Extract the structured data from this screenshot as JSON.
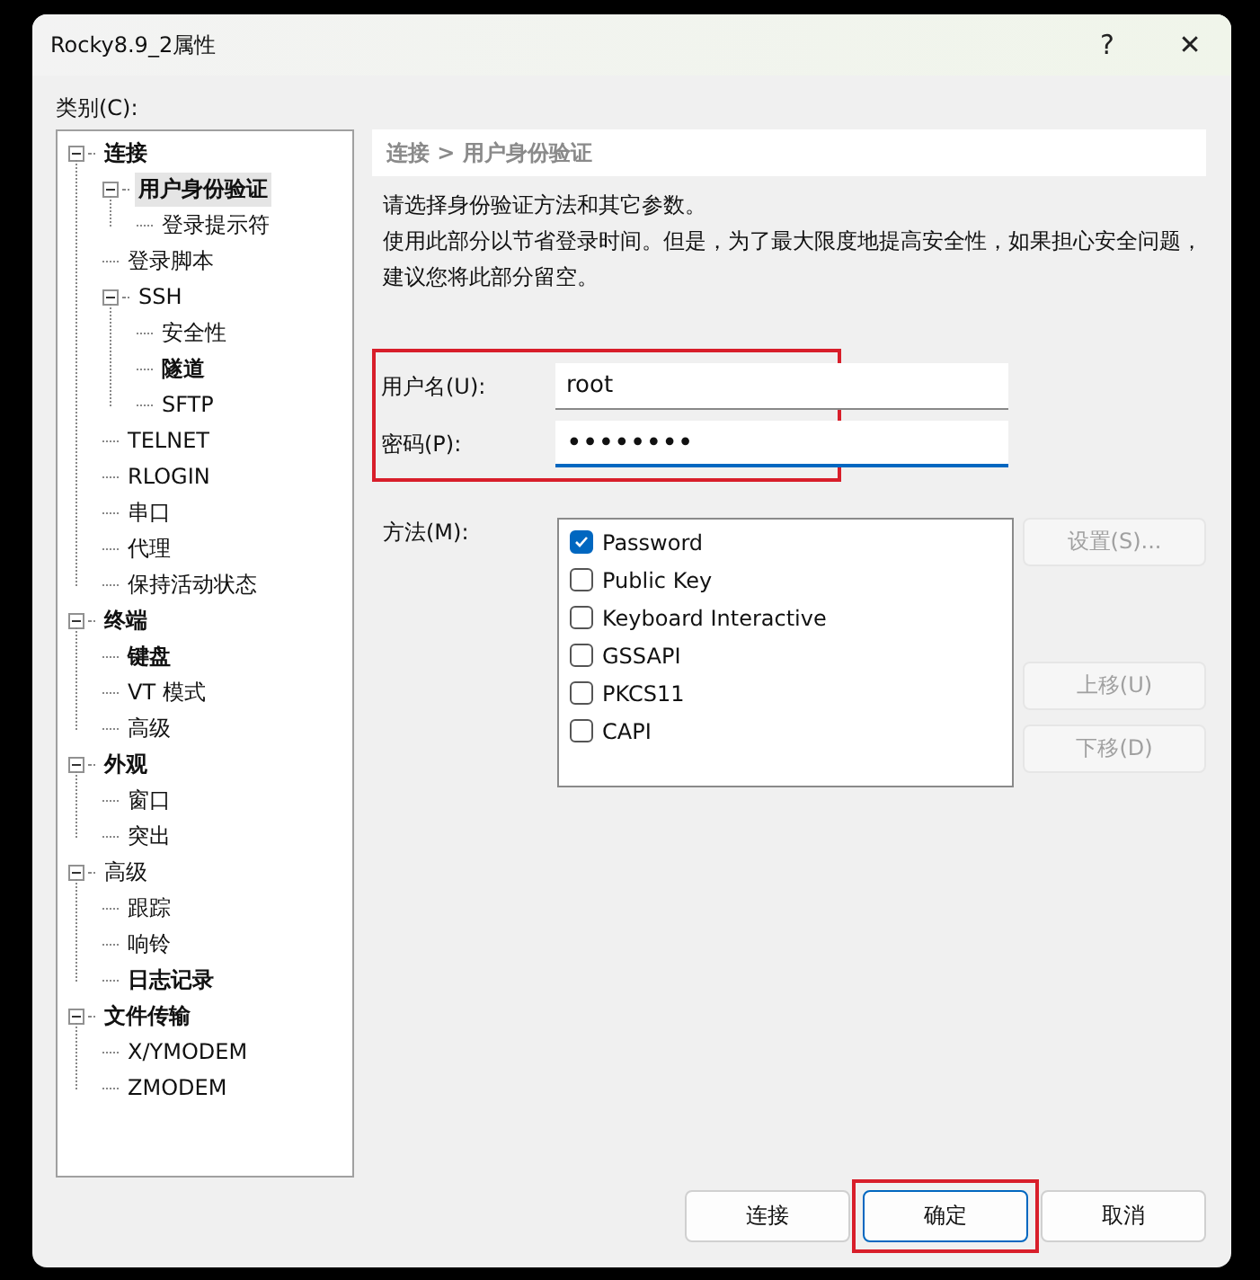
{
  "window": {
    "title": "Rocky8.9_2属性",
    "help": "?",
    "close": "✕"
  },
  "category_label": "类别(C):",
  "tree": [
    {
      "label": "连接",
      "bold": true,
      "selected": false,
      "expanded": true,
      "children": [
        {
          "label": "用户身份验证",
          "bold": true,
          "selected": true,
          "expanded": true,
          "children": [
            {
              "label": "登录提示符",
              "bold": false,
              "selected": false
            }
          ]
        },
        {
          "label": "登录脚本",
          "bold": false,
          "selected": false
        },
        {
          "label": "SSH",
          "bold": false,
          "selected": false,
          "expanded": true,
          "children": [
            {
              "label": "安全性",
              "bold": false,
              "selected": false
            },
            {
              "label": "隧道",
              "bold": true,
              "selected": false
            },
            {
              "label": "SFTP",
              "bold": false,
              "selected": false
            }
          ]
        },
        {
          "label": "TELNET",
          "bold": false,
          "selected": false
        },
        {
          "label": "RLOGIN",
          "bold": false,
          "selected": false
        },
        {
          "label": "串口",
          "bold": false,
          "selected": false
        },
        {
          "label": "代理",
          "bold": false,
          "selected": false
        },
        {
          "label": "保持活动状态",
          "bold": false,
          "selected": false
        }
      ]
    },
    {
      "label": "终端",
      "bold": true,
      "selected": false,
      "expanded": true,
      "children": [
        {
          "label": "键盘",
          "bold": true,
          "selected": false
        },
        {
          "label": "VT 模式",
          "bold": false,
          "selected": false
        },
        {
          "label": "高级",
          "bold": false,
          "selected": false
        }
      ]
    },
    {
      "label": "外观",
      "bold": true,
      "selected": false,
      "expanded": true,
      "children": [
        {
          "label": "窗口",
          "bold": false,
          "selected": false
        },
        {
          "label": "突出",
          "bold": false,
          "selected": false
        }
      ]
    },
    {
      "label": "高级",
      "bold": false,
      "selected": false,
      "expanded": true,
      "children": [
        {
          "label": "跟踪",
          "bold": false,
          "selected": false
        },
        {
          "label": "响铃",
          "bold": false,
          "selected": false
        },
        {
          "label": "日志记录",
          "bold": true,
          "selected": false
        }
      ]
    },
    {
      "label": "文件传输",
      "bold": true,
      "selected": false,
      "expanded": true,
      "children": [
        {
          "label": "X/YMODEM",
          "bold": false,
          "selected": false
        },
        {
          "label": "ZMODEM",
          "bold": false,
          "selected": false
        }
      ]
    }
  ],
  "breadcrumb": "连接 > 用户身份验证",
  "intro": "请选择身份验证方法和其它参数。",
  "note": "使用此部分以节省登录时间。但是，为了最大限度地提高安全性，如果担心安全问题，建议您将此部分留空。",
  "credentials": {
    "annotated": true,
    "fields": [
      {
        "label": "用户名(U):",
        "value": "root",
        "kind": "text",
        "focused": false
      },
      {
        "label": "密码(P):",
        "value": "••••••••",
        "kind": "password",
        "focused": true
      }
    ]
  },
  "method_label": "方法(M):",
  "methods": [
    {
      "label": "Password",
      "checked": true
    },
    {
      "label": "Public Key",
      "checked": false
    },
    {
      "label": "Keyboard Interactive",
      "checked": false
    },
    {
      "label": "GSSAPI",
      "checked": false
    },
    {
      "label": "PKCS11",
      "checked": false
    },
    {
      "label": "CAPI",
      "checked": false
    }
  ],
  "side_buttons": [
    {
      "label": "设置(S)...",
      "disabled": true
    },
    {
      "label": "上移(U)",
      "disabled": true
    },
    {
      "label": "下移(D)",
      "disabled": true
    }
  ],
  "footer_buttons": [
    {
      "label": "连接",
      "default": false,
      "annotated": false
    },
    {
      "label": "确定",
      "default": true,
      "annotated": true
    },
    {
      "label": "取消",
      "default": false,
      "annotated": false
    }
  ]
}
